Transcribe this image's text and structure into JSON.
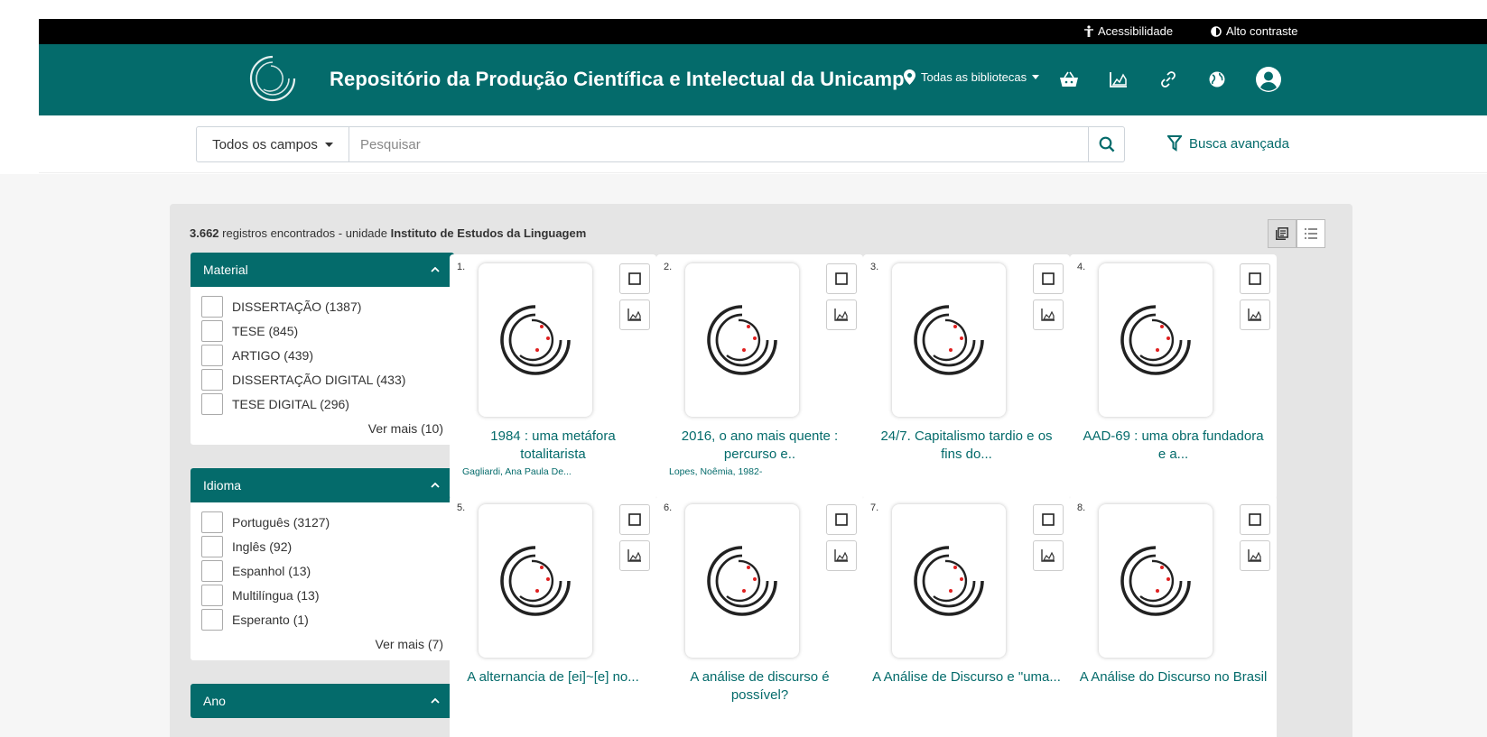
{
  "topbar": {
    "accessibility_label": "Acessibilidade",
    "contrast_label": "Alto contraste"
  },
  "header": {
    "title": "Repositório da Produção Científica e Intelectual da Unicamp",
    "library_select": "Todas as bibliotecas"
  },
  "search": {
    "field_select": "Todos os campos",
    "placeholder": "Pesquisar",
    "value": "",
    "advanced_label": "Busca avançada"
  },
  "results_summary": {
    "count": "3.662",
    "text": " registros encontrados - unidade ",
    "unit": "Instituto de Estudos da Linguagem"
  },
  "facets": {
    "material": {
      "title": "Material",
      "items": [
        "DISSERTAÇÃO (1387)",
        "TESE (845)",
        "ARTIGO (439)",
        "DISSERTAÇÃO DIGITAL (433)",
        "TESE DIGITAL (296)"
      ],
      "more": "Ver mais (10)"
    },
    "idioma": {
      "title": "Idioma",
      "items": [
        "Português (3127)",
        "Inglês (92)",
        "Espanhol (13)",
        "Multilíngua (13)",
        "Esperanto (1)"
      ],
      "more": "Ver mais (7)"
    },
    "ano": {
      "title": "Ano"
    }
  },
  "results": [
    {
      "num": "1.",
      "title": "1984 : uma metáfora totalitarista",
      "author": "Gagliardi, Ana Paula De..."
    },
    {
      "num": "2.",
      "title": "2016, o ano mais quente : percurso e..",
      "author": "Lopes, Noêmia, 1982-"
    },
    {
      "num": "3.",
      "title": "24/7. Capitalismo tardio e os fins do...",
      "author": ""
    },
    {
      "num": "4.",
      "title": "AAD-69 : uma obra fundadora e a...",
      "author": ""
    },
    {
      "num": "5.",
      "title": "A alternancia de [ei]~[e] no...",
      "author": ""
    },
    {
      "num": "6.",
      "title": "A análise de discurso é possível?",
      "author": ""
    },
    {
      "num": "7.",
      "title": "A Análise de Discurso e \"uma...",
      "author": ""
    },
    {
      "num": "8.",
      "title": "A Análise do Discurso no Brasil",
      "author": ""
    }
  ],
  "colors": {
    "brand": "#046b6b",
    "logo_dot": "#e02020"
  },
  "icons": {
    "accessibility": "person-icon",
    "contrast": "half-circle-icon",
    "location": "map-pin-icon",
    "basket": "basket-icon",
    "stats": "chart-area-icon",
    "link": "link-icon",
    "language": "globe-icon",
    "user": "user-circle-icon",
    "search": "search-icon",
    "filter": "filter-icon"
  }
}
